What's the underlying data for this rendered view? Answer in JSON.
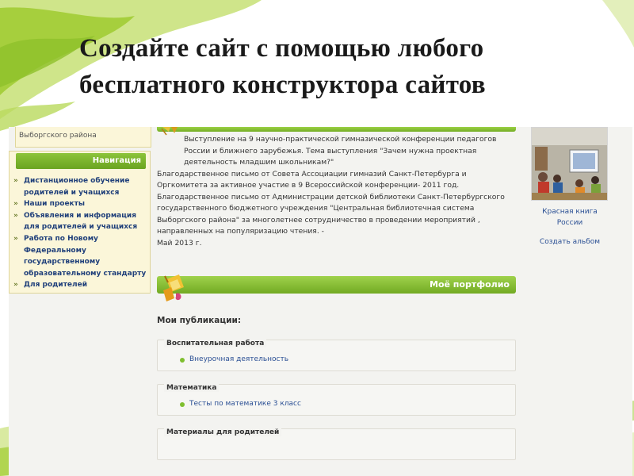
{
  "slide": {
    "title_line1": "Создайте сайт с помощью любого",
    "title_line2": "бесплатного конструктора сайтов"
  },
  "site": {
    "sidebar": {
      "district_text": "Выборгского района",
      "nav_header": "Навигация",
      "nav_items": [
        "Дистанционное обучение родителей и учащихся",
        "Наши проекты",
        "Объявления и информация для родителей и учащихся",
        "Работа по Новому Федеральному государственному образовательному стандарту",
        "Для родителей"
      ]
    },
    "news": {
      "para1": "Выступление на 9 научно-практической гимназической конференции педагогов России и ближнего зарубежья. Тема выступления \"Зачем нужна проектная деятельность младшим школьникам?\"",
      "para2": "Благодарственное письмо от Совета Ассоциации гимназий Санкт-Петербурга и Оргкомитета за активное участие в 9 Всероссийской конференции- 2011 год.",
      "para3": "Благодарственное письмо от Администрации детской библиотеки Санкт-Петербургского государственного бюджетного учреждения \"Центральная библиотечная система Выборгского района\" за многолетнее сотрудничество в проведении мероприятий , направленных на популяризацию чтения. -",
      "date": "Май 2013 г."
    },
    "portfolio": {
      "title": "Моё портфолио",
      "publications_heading": "Мои публикации:",
      "categories": [
        {
          "name": "Воспитательная работа",
          "link": "Внеурочная деятельность"
        },
        {
          "name": "Математика",
          "link": "Тесты по математике 3 класс"
        },
        {
          "name": "Материалы для родителей",
          "link": ""
        }
      ]
    },
    "album": {
      "name_line1": "Красная книга",
      "name_line2": "России",
      "create_label": "Создать альбом"
    }
  }
}
